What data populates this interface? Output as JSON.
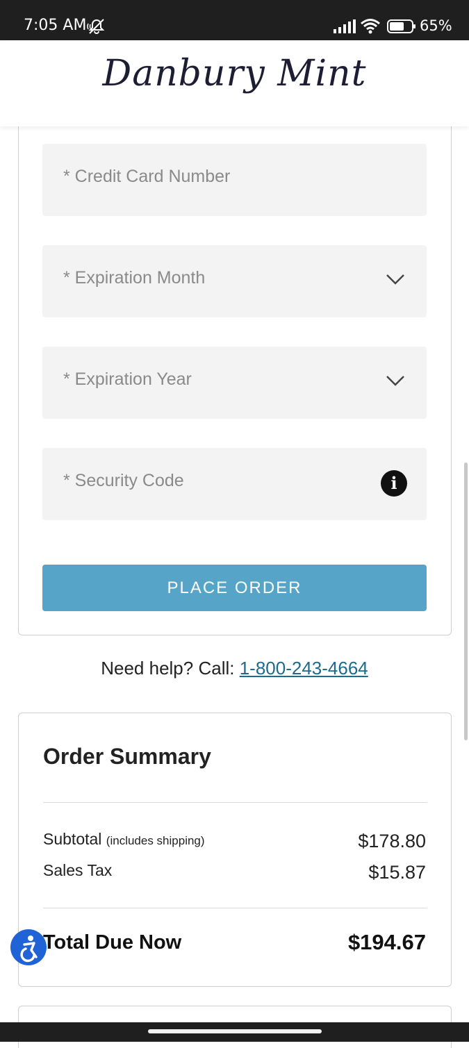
{
  "status_bar": {
    "time": "7:05 AM",
    "battery": "65%",
    "icons": [
      "mute-icon",
      "signal-icon",
      "wifi-icon",
      "battery-icon"
    ]
  },
  "header": {
    "logo_text": "Danbury Mint"
  },
  "payment": {
    "fields": {
      "card_number": "* Credit Card Number",
      "exp_month": "* Expiration Month",
      "exp_year": "* Expiration Year",
      "security_code": "* Security Code"
    },
    "place_order_label": "PLACE ORDER"
  },
  "help": {
    "prefix": "Need help? Call: ",
    "phone": "1-800-243-4664"
  },
  "summary": {
    "title": "Order Summary",
    "subtotal_label": "Subtotal",
    "subtotal_note": "(includes shipping)",
    "subtotal_value": "$178.80",
    "tax_label": "Sales Tax",
    "tax_value": "$15.87",
    "total_label": "Total Due Now",
    "total_value": "$194.67"
  },
  "colors": {
    "accent_button": "#56a5c8",
    "link": "#1c6b8e",
    "accessibility": "#1f63d6"
  }
}
